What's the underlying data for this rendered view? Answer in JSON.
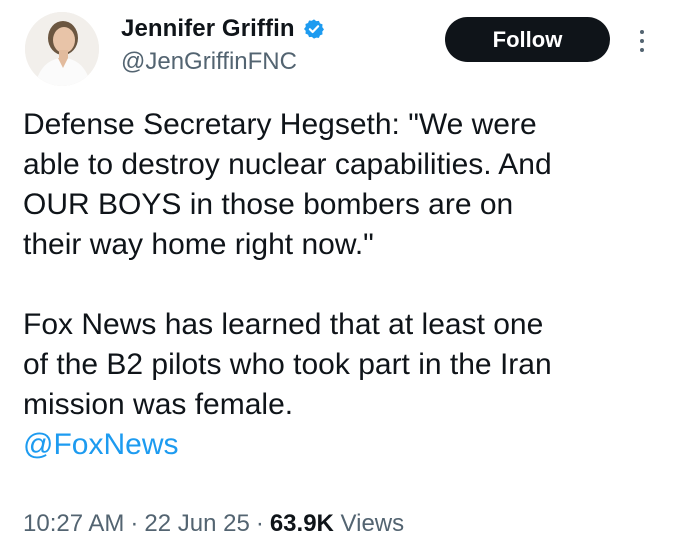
{
  "author": {
    "display_name": "Jennifer Griffin",
    "handle": "@JenGriffinFNC",
    "verified": true,
    "avatar_icon": "profile-photo"
  },
  "actions": {
    "follow_label": "Follow",
    "more_icon": "more-vertical-icon"
  },
  "tweet": {
    "paragraph_1": "Defense Secretary Hegseth: \"We were\nable to destroy nuclear capabilities. And\nOUR BOYS in those bombers are on\ntheir way home right now.\"",
    "paragraph_2": "Fox News has learned that at least one\nof the B2 pilots who took part in the Iran\nmission was female.",
    "mention": "@FoxNews"
  },
  "meta": {
    "time": "10:27 AM",
    "separator": "·",
    "date": "22 Jun 25",
    "views_count": "63.9K",
    "views_label": "Views"
  },
  "colors": {
    "text": "#0f1419",
    "secondary": "#536471",
    "link": "#1d9bf0",
    "button_bg": "#0f1419",
    "verified": "#1d9bf0"
  }
}
